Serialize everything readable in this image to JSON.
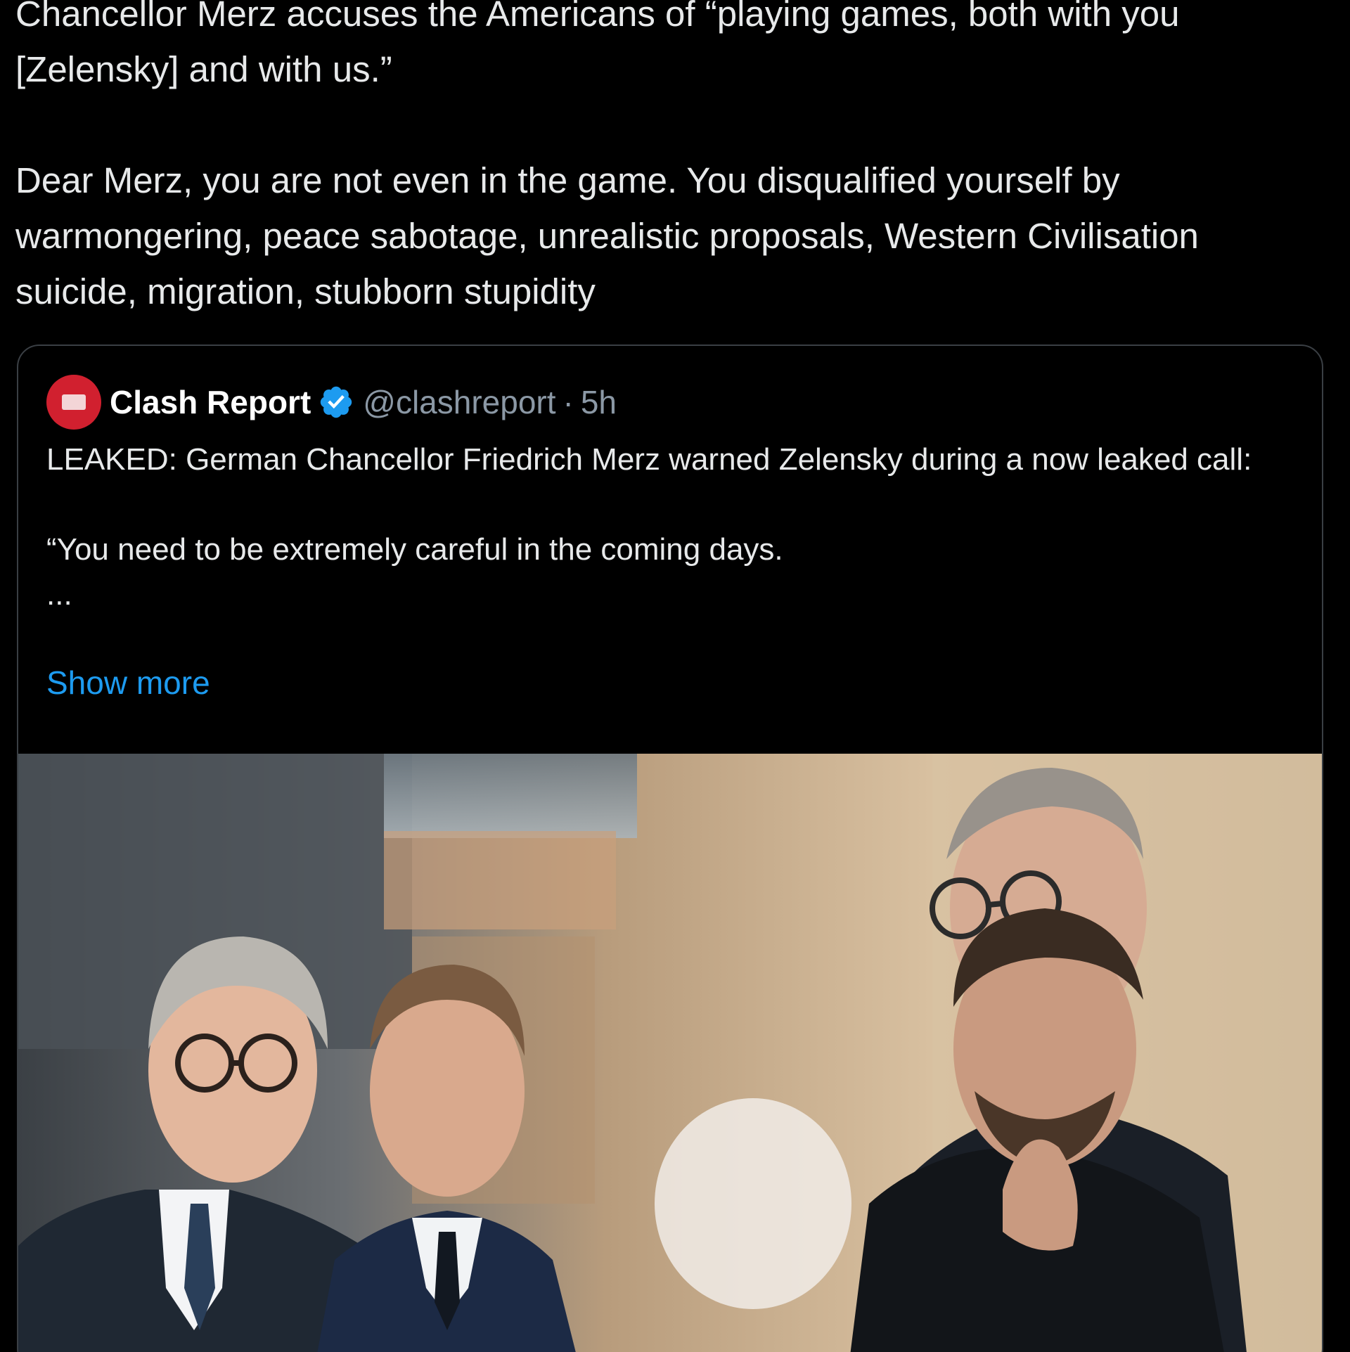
{
  "post": {
    "text": "Chancellor Merz accuses the Americans of “playing games, both with you [Zelensky] and with us.”\n\nDear Merz, you are not even in the game. You disqualified yourself by warmongering, peace sabotage, unrealistic proposals, Western Civilisation suicide, migration, stubborn stupidity"
  },
  "quoted": {
    "author_name": "Clash Report",
    "handle": "@clashreport",
    "separator": "·",
    "time": "5h",
    "body": "LEAKED: German Chancellor Friedrich Merz warned Zelensky during a now leaked call:\n\n“You need to be extremely careful in the coming days.\n...",
    "show_more": "Show more",
    "verified_icon": "verified-badge-icon",
    "avatar_icon": "clash-report-avatar",
    "image_alt": "photo-four-men-outdoors"
  },
  "colors": {
    "background": "#000000",
    "text": "#e7e9ea",
    "muted": "#8b98a5",
    "link": "#1d9bf0",
    "verified": "#1d9bf0",
    "avatar": "#d1202f"
  }
}
